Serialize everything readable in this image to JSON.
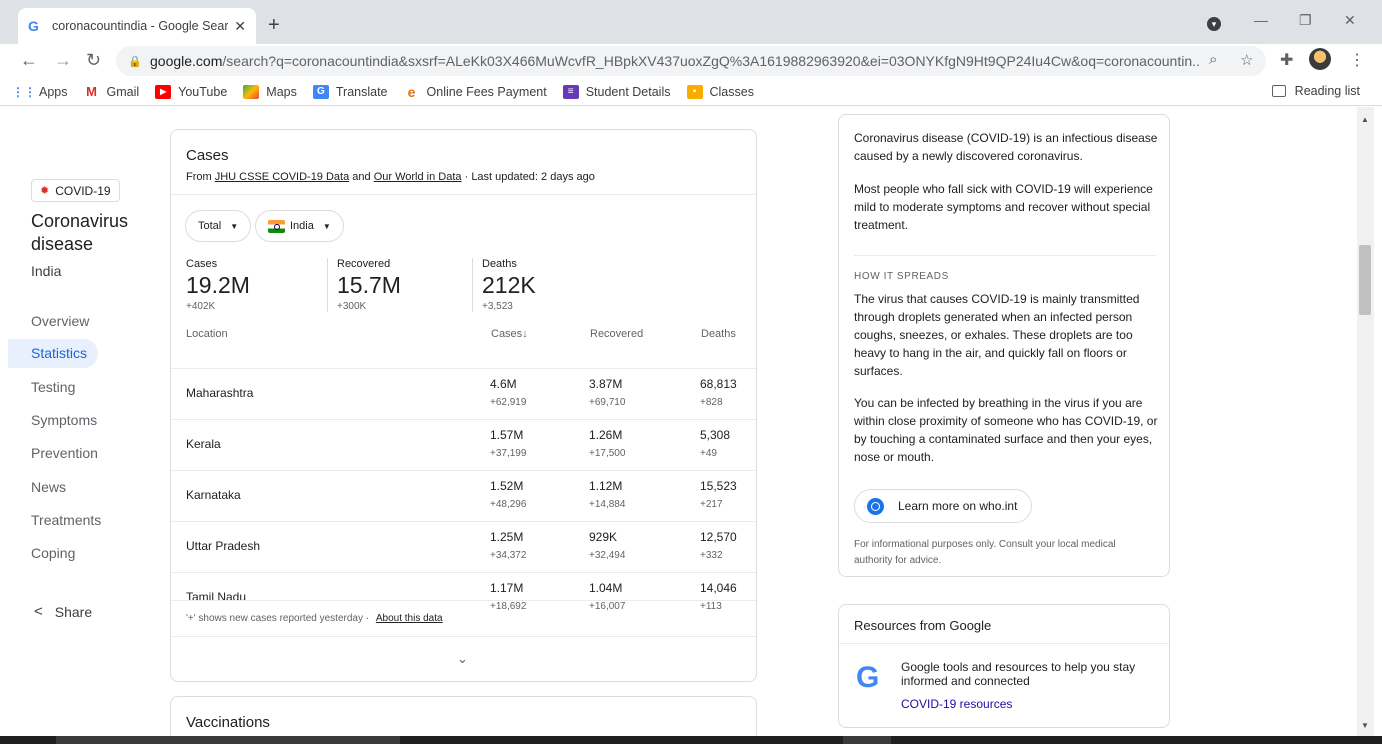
{
  "browser": {
    "tab_title": "coronacountindia - Google Search",
    "url_host": "google.com",
    "url_rest": "/search?q=coronacountindia&sxsrf=ALeKk03X466MuWcvfR_HBpkXV437uoxZgQ%3A1619882963920&ei=03ONYKfgN9Ht9QP24Iu4Cw&oq=coronacountin...",
    "bookmarks": [
      {
        "label": "Apps",
        "icon": "apps-grid-icon",
        "color": "#4285f4"
      },
      {
        "label": "Gmail",
        "icon": "gmail-icon",
        "color": "#d93025"
      },
      {
        "label": "YouTube",
        "icon": "youtube-icon",
        "color": "#ff0000"
      },
      {
        "label": "Maps",
        "icon": "maps-icon",
        "color": "#34a853"
      },
      {
        "label": "Translate",
        "icon": "translate-icon",
        "color": "#4285f4"
      },
      {
        "label": "Online Fees Payment",
        "icon": "fees-icon",
        "color": "#e8710a"
      },
      {
        "label": "Student Details",
        "icon": "student-details-icon",
        "color": "#673ab7"
      },
      {
        "label": "Classes",
        "icon": "classes-icon",
        "color": "#f9ab00"
      }
    ],
    "reading_list": "Reading list"
  },
  "leftnav": {
    "badge": "COVID-19",
    "topic": "Coronavirus disease",
    "region": "India",
    "items": [
      "Overview",
      "Statistics",
      "Testing",
      "Symptoms",
      "Prevention",
      "News",
      "Treatments",
      "Coping"
    ],
    "active": "Statistics",
    "share": "Share"
  },
  "cases_card": {
    "title": "Cases",
    "source_prefix": "From",
    "source1": "JHU CSSE COVID-19 Data",
    "source_and": "and",
    "source2": "Our World in Data",
    "updated": "· Last updated: 2 days ago",
    "filter_total": "Total",
    "filter_region": "India",
    "stats": [
      {
        "label": "Cases",
        "value": "19.2M",
        "delta": "+402K"
      },
      {
        "label": "Recovered",
        "value": "15.7M",
        "delta": "+300K"
      },
      {
        "label": "Deaths",
        "value": "212K",
        "delta": "+3,523"
      }
    ],
    "columns": {
      "location": "Location",
      "cases": "Cases",
      "recovered": "Recovered",
      "deaths": "Deaths"
    },
    "rows": [
      {
        "location": "Maharashtra",
        "cases": "4.6M",
        "cases_d": "+62,919",
        "recovered": "3.87M",
        "recovered_d": "+69,710",
        "deaths": "68,813",
        "deaths_d": "+828"
      },
      {
        "location": "Kerala",
        "cases": "1.57M",
        "cases_d": "+37,199",
        "recovered": "1.26M",
        "recovered_d": "+17,500",
        "deaths": "5,308",
        "deaths_d": "+49"
      },
      {
        "location": "Karnataka",
        "cases": "1.52M",
        "cases_d": "+48,296",
        "recovered": "1.12M",
        "recovered_d": "+14,884",
        "deaths": "15,523",
        "deaths_d": "+217"
      },
      {
        "location": "Uttar Pradesh",
        "cases": "1.25M",
        "cases_d": "+34,372",
        "recovered": "929K",
        "recovered_d": "+32,494",
        "deaths": "12,570",
        "deaths_d": "+332"
      },
      {
        "location": "Tamil Nadu",
        "cases": "1.17M",
        "cases_d": "+18,692",
        "recovered": "1.04M",
        "recovered_d": "+16,007",
        "deaths": "14,046",
        "deaths_d": "+113"
      }
    ],
    "footnote": "'+' shows new cases reported yesterday ·",
    "about": "About this data"
  },
  "vaccinations_title": "Vaccinations",
  "info_card": {
    "p1": "Coronavirus disease (COVID-19) is an infectious disease caused by a newly discovered coronavirus.",
    "p2": "Most people who fall sick with COVID-19 will experience mild to moderate symptoms and recover without special treatment.",
    "section": "HOW IT SPREADS",
    "p3": "The virus that causes COVID-19 is mainly transmitted through droplets generated when an infected person coughs, sneezes, or exhales. These droplets are too heavy to hang in the air, and quickly fall on floors or surfaces.",
    "p4": "You can be infected by breathing in the virus if you are within close proximity of someone who has COVID-19, or by touching a contaminated surface and then your eyes, nose or mouth.",
    "who_button": "Learn more on who.int",
    "disclaimer": "For informational purposes only. Consult your local medical authority for advice."
  },
  "resources_card": {
    "title": "Resources from Google",
    "desc": "Google tools and resources to help you stay informed and connected",
    "link": "COVID-19 resources"
  }
}
